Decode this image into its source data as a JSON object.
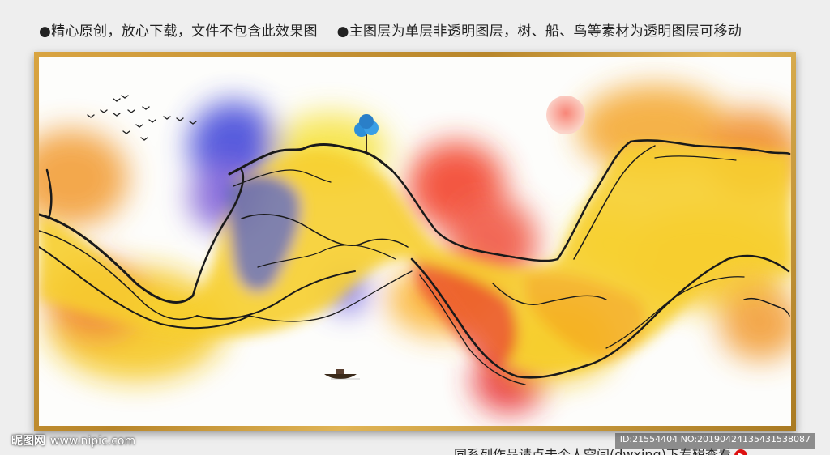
{
  "top_caption": {
    "left_text": "●精心原创，放心下载，文件不包含此效果图",
    "right_text": "●主图层为单层非透明图层，树、船、鸟等素材为透明图层可移动"
  },
  "painting": {
    "icons": [
      "birds-icon",
      "tree-icon",
      "sun-icon",
      "boat-icon"
    ],
    "colors": {
      "frame_gold": "#c9973a",
      "mountain_yellow": "#f5c518",
      "ink_red": "#e8262a",
      "ink_orange": "#f08a24",
      "ink_blue": "#3a3fd8",
      "ink_violet": "#7a5ad6",
      "sun_red": "#f26b5e"
    }
  },
  "watermark": {
    "brand": "昵图网",
    "site": "www.nipic.com"
  },
  "id_line": "ID:21554404 NO:20190424135431538087",
  "bottom_caption": {
    "text": "同系列作品请点击个人空间(dwxing)下专辑查看"
  }
}
